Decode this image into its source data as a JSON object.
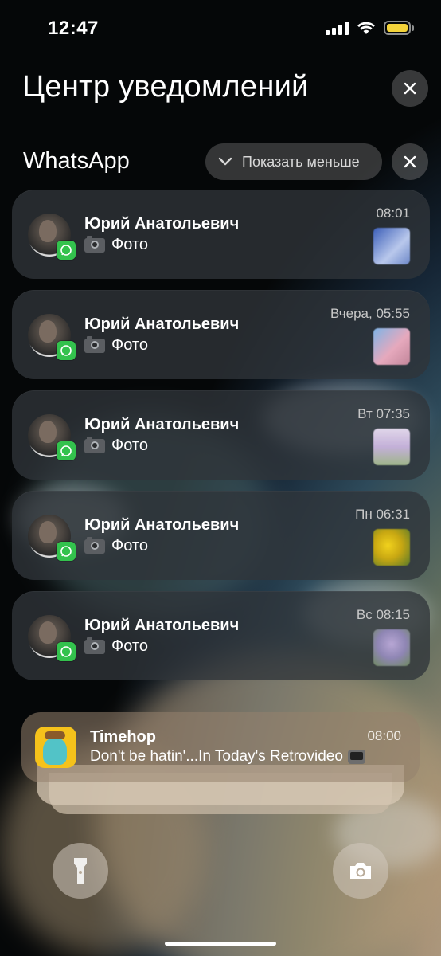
{
  "status_bar": {
    "time": "12:47"
  },
  "header": {
    "title": "Центр уведомлений"
  },
  "group": {
    "app_name": "WhatsApp",
    "show_less_label": "Показать меньше"
  },
  "notifications": [
    {
      "sender": "Юрий Анатольевич",
      "message": "Фото",
      "time": "08:01",
      "thumb_color": "#6d88c8"
    },
    {
      "sender": "Юрий Анатольевич",
      "message": "Фото",
      "time": "Вчера, 05:55",
      "thumb_color": "#d8a5b6"
    },
    {
      "sender": "Юрий Анатольевич",
      "message": "Фото",
      "time": "Вт 07:35",
      "thumb_color": "#c3b0d8"
    },
    {
      "sender": "Юрий Анатольевич",
      "message": "Фото",
      "time": "Пн 06:31",
      "thumb_color": "#d9c12a"
    },
    {
      "sender": "Юрий Анатольевич",
      "message": "Фото",
      "time": "Вс 08:15",
      "thumb_color": "#a897c4"
    }
  ],
  "timehop": {
    "app_name": "Timehop",
    "body": "Don't be hatin'...In Today's Retrovideo",
    "time": "08:00"
  },
  "icons": [
    "close-icon",
    "chevron-down-icon",
    "whatsapp-icon",
    "camera-emoji-icon",
    "tv-emoji-icon",
    "flashlight-icon",
    "camera-icon"
  ]
}
